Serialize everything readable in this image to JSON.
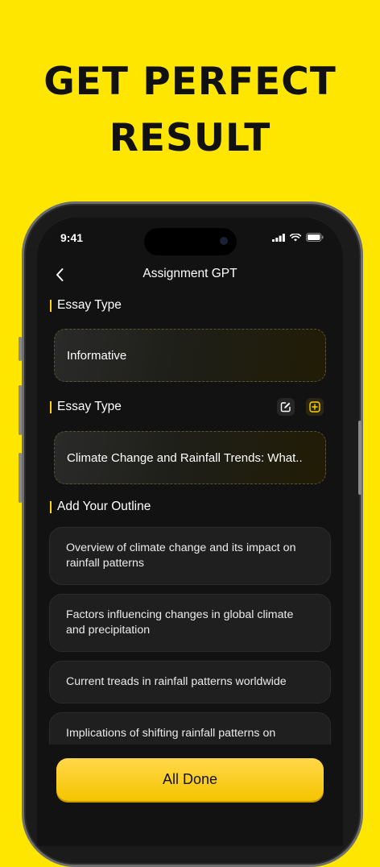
{
  "promo": {
    "headline_line1": "GET PERFECT",
    "headline_line2": "RESULT"
  },
  "status_bar": {
    "time": "9:41"
  },
  "header": {
    "title": "Assignment GPT",
    "back_icon": "chevron-left-icon"
  },
  "sections": {
    "essay_type_1": {
      "label": "Essay Type",
      "value": "Informative"
    },
    "essay_type_2": {
      "label": "Essay Type",
      "value": "Climate Change and Rainfall Trends: What..",
      "edit_icon": "edit-icon",
      "add_icon": "plus-square-icon"
    },
    "outline": {
      "label": "Add Your Outline",
      "items": [
        "Overview of climate change and its impact on rainfall patterns",
        "Factors influencing changes in global climate and precipitation",
        "Current treads in rainfall patterns worldwide",
        "Implications of shifting rainfall patterns on"
      ]
    }
  },
  "actions": {
    "done_label": "All Done"
  },
  "colors": {
    "background": "#FFE600",
    "accent": "#FFD400",
    "screen": "#121212"
  }
}
